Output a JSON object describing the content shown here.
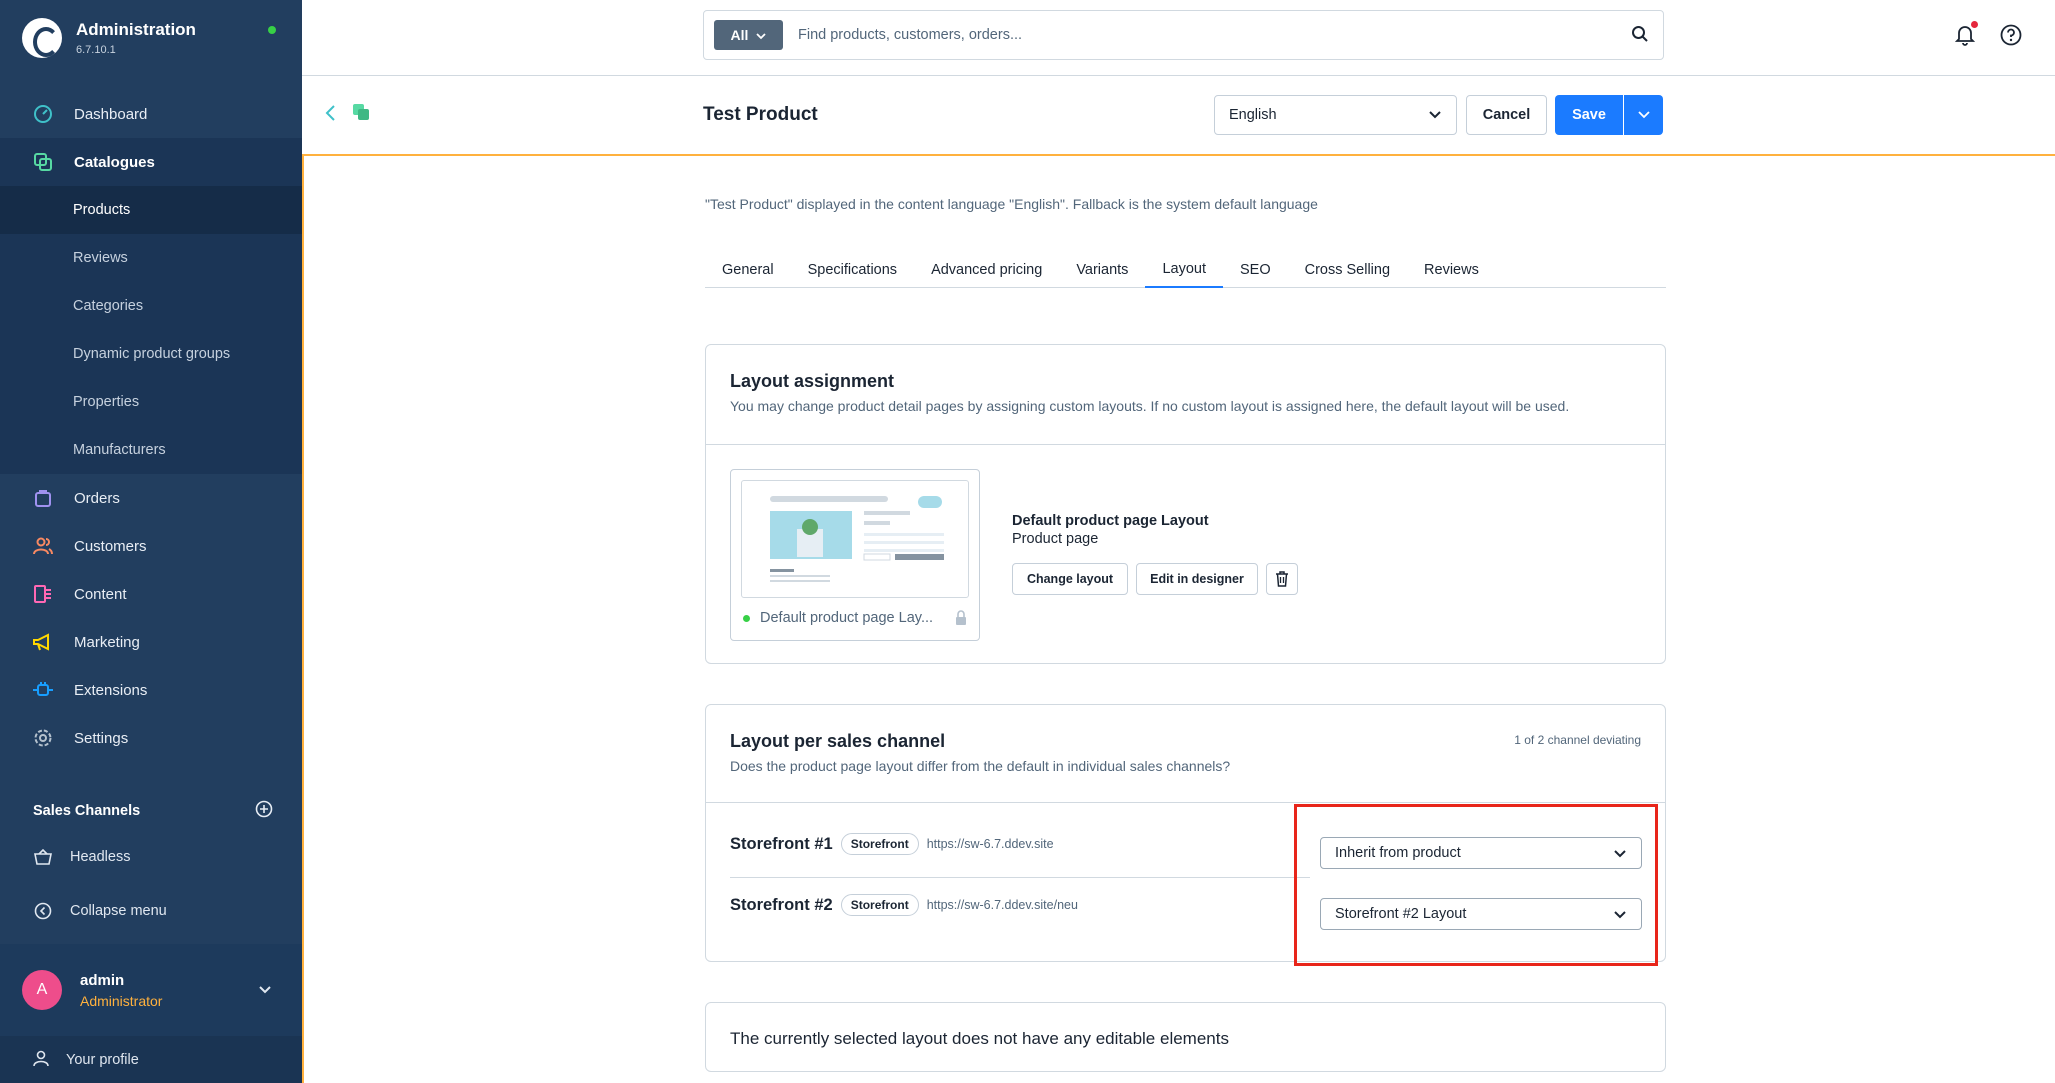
{
  "app": {
    "title": "Administration",
    "version": "6.7.10.1"
  },
  "nav": {
    "dashboard": "Dashboard",
    "catalogues": "Catalogues",
    "sub": [
      "Products",
      "Reviews",
      "Categories",
      "Dynamic product groups",
      "Properties",
      "Manufacturers"
    ],
    "orders": "Orders",
    "customers": "Customers",
    "content": "Content",
    "marketing": "Marketing",
    "extensions": "Extensions",
    "settings": "Settings"
  },
  "sales_channels": {
    "header": "Sales Channels",
    "headless": "Headless",
    "collapse": "Collapse menu"
  },
  "user": {
    "initial": "A",
    "name": "admin",
    "role": "Administrator",
    "profile": "Your profile"
  },
  "search": {
    "type": "All",
    "placeholder": "Find products, customers, orders..."
  },
  "smartbar": {
    "title": "Test Product",
    "language": "English",
    "cancel": "Cancel",
    "save": "Save"
  },
  "hint": "\"Test Product\" displayed in the content language \"English\". Fallback is the system default language",
  "tabs": [
    "General",
    "Specifications",
    "Advanced pricing",
    "Variants",
    "Layout",
    "SEO",
    "Cross Selling",
    "Reviews"
  ],
  "active_tab": "Layout",
  "layout_assignment": {
    "title": "Layout assignment",
    "subtitle": "You may change product detail pages by assigning custom layouts. If no custom layout is assigned here, the default layout will be used.",
    "preview_caption": "Default product page Lay...",
    "layout_name": "Default product page Layout",
    "layout_type": "Product page",
    "change_btn": "Change layout",
    "designer_btn": "Edit in designer"
  },
  "layout_per_channel": {
    "title": "Layout per sales channel",
    "subtitle": "Does the product page layout differ from the default in individual sales channels?",
    "deviating": "1 of 2 channel deviating",
    "rows": [
      {
        "name": "Storefront #1",
        "badge": "Storefront",
        "url": "https://sw-6.7.ddev.site",
        "selected": "Inherit from product"
      },
      {
        "name": "Storefront #2",
        "badge": "Storefront",
        "url": "https://sw-6.7.ddev.site/neu",
        "selected": "Storefront #2 Layout"
      }
    ]
  },
  "no_elements": "The currently selected layout does not have any editable elements",
  "colors": {
    "sidebar": "#223e5f",
    "accent": "#1b7bff",
    "highlight": "#e8251a",
    "orange": "#ffb13e"
  }
}
